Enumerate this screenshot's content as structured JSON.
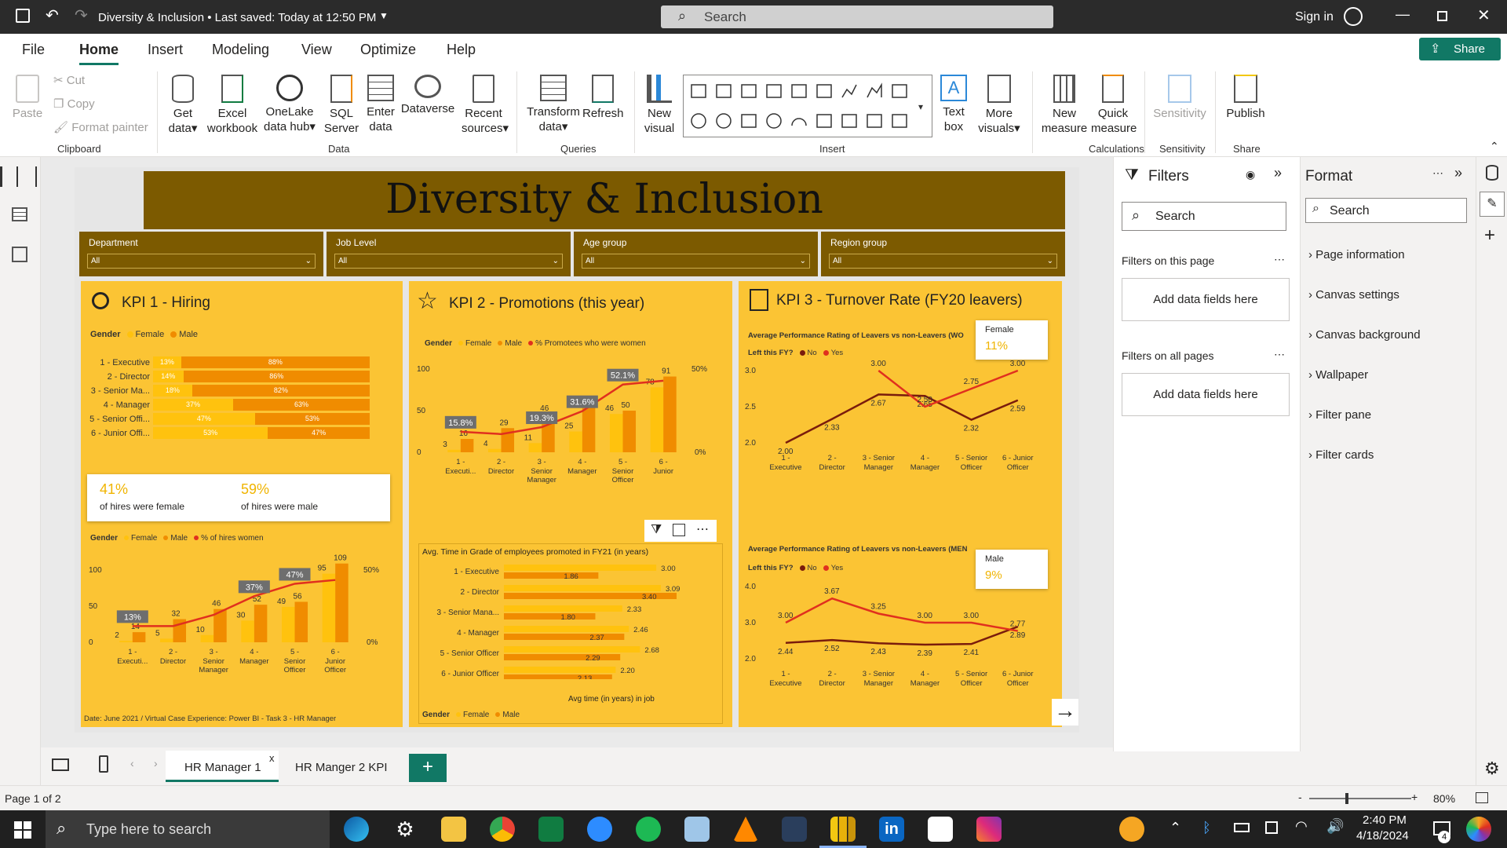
{
  "titlebar": {
    "title": "Diversity & Inclusion • Last saved: Today at 12:50 PM",
    "search": "Search",
    "signin": "Sign in"
  },
  "menu": {
    "items": [
      "File",
      "Home",
      "Insert",
      "Modeling",
      "View",
      "Optimize",
      "Help"
    ],
    "share": "Share"
  },
  "ribbon": {
    "clipboard": {
      "paste": "Paste",
      "cut": "Cut",
      "copy": "Copy",
      "format_painter": "Format painter",
      "group": "Clipboard"
    },
    "data": {
      "get_data": "Get data",
      "excel": "Excel workbook",
      "onelake": "OneLake data hub",
      "sql": "SQL Server",
      "enter": "Enter data",
      "dataverse": "Dataverse",
      "recent": "Recent sources",
      "group": "Data"
    },
    "queries": {
      "transform": "Transform data",
      "refresh": "Refresh",
      "group": "Queries"
    },
    "insert": {
      "new_visual": "New visual",
      "text_box": "Text box",
      "more_visuals": "More visuals",
      "group": "Insert"
    },
    "calculations": {
      "new_measure": "New measure",
      "quick_measure": "Quick measure",
      "group": "Calculations"
    },
    "sensitivity": {
      "label": "Sensitivity",
      "group": "Sensitivity"
    },
    "share": {
      "publish": "Publish",
      "group": "Share"
    }
  },
  "report": {
    "title": "Diversity & Inclusion",
    "slicers": [
      {
        "label": "Department",
        "value": "All"
      },
      {
        "label": "Job Level",
        "value": "All"
      },
      {
        "label": "Age group",
        "value": "All"
      },
      {
        "label": "Region group",
        "value": "All"
      }
    ],
    "kpi1": {
      "title": "KPI 1 - Hiring",
      "legend_title": "Gender",
      "legend": [
        "Female",
        "Male"
      ],
      "rows": [
        {
          "label": "1 - Executive",
          "female": "13%",
          "male": "88%",
          "f": 13
        },
        {
          "label": "2 - Director",
          "female": "14%",
          "male": "86%",
          "f": 14
        },
        {
          "label": "3 - Senior Ma...",
          "female": "18%",
          "male": "82%",
          "f": 18
        },
        {
          "label": "4 - Manager",
          "female": "37%",
          "male": "63%",
          "f": 37
        },
        {
          "label": "5 - Senior Offi...",
          "female": "47%",
          "male": "53%",
          "f": 47
        },
        {
          "label": "6 - Junior Offi...",
          "female": "53%",
          "male": "47%",
          "f": 53
        }
      ],
      "card": {
        "female_value": "41%",
        "female_label": "of hires were female",
        "male_value": "59%",
        "male_label": "of hires were male"
      },
      "chart_legend": [
        "Female",
        "Male",
        "% of hires women"
      ],
      "footer": "Date: June 2021 / Virtual Case Experience: Power BI - Task 3 - HR Manager"
    },
    "kpi2": {
      "title": "KPI 2 - Promotions (this year)",
      "legend_title": "Gender",
      "legend": [
        "Female",
        "Male",
        "% Promotees who were women"
      ],
      "table_title": "Avg. Time in Grade of employees promoted in FY21 (in years)",
      "table_xlabel": "Avg time (in years) in job",
      "rows": [
        {
          "label": "1 - Executive",
          "a": "1.86",
          "b": "3.00",
          "av": 1.86,
          "bv": 3.0
        },
        {
          "label": "2 - Director",
          "a": "3.40",
          "b": "3.09",
          "av": 3.4,
          "bv": 3.09
        },
        {
          "label": "3 - Senior Mana...",
          "a": "1.80",
          "b": "2.33",
          "av": 1.8,
          "bv": 2.33
        },
        {
          "label": "4 - Manager",
          "a": "2.37",
          "b": "2.46",
          "av": 2.37,
          "bv": 2.46
        },
        {
          "label": "5 - Senior Officer",
          "a": "2.29",
          "b": "2.68",
          "av": 2.29,
          "bv": 2.68
        },
        {
          "label": "6 - Junior Officer",
          "a": "2.13",
          "b": "2.20",
          "av": 2.13,
          "bv": 2.2
        }
      ],
      "bottom_legend": [
        "Female",
        "Male"
      ]
    },
    "kpi3": {
      "title": "KPI 3 - Turnover Rate (FY20 leavers)",
      "top": {
        "subtitle": "Average Performance Rating of Leavers vs non-Leavers (WO",
        "left_label": "Left this FY?",
        "legend": [
          "No",
          "Yes"
        ],
        "card_title": "Female",
        "card_value": "11%"
      },
      "bottom": {
        "subtitle": "Average Performance Rating of Leavers vs non-Leavers (MEN",
        "left_label": "Left this FY?",
        "legend": [
          "No",
          "Yes"
        ],
        "card_title": "Male",
        "card_value": "9%"
      }
    }
  },
  "chart_data": [
    {
      "type": "bar",
      "title": "KPI 1 - Hiring",
      "categories": [
        "1 - Executive",
        "2 - Director",
        "3 - Senior Manager",
        "4 - Manager",
        "5 - Senior Officer",
        "6 - Junior Officer"
      ],
      "series": [
        {
          "name": "Female",
          "values": [
            13,
            14,
            18,
            37,
            47,
            53
          ]
        },
        {
          "name": "Male",
          "values": [
            88,
            86,
            82,
            63,
            53,
            47
          ]
        }
      ]
    },
    {
      "type": "bar",
      "categories": [
        "1 - Executi...",
        "2 - Director",
        "3 - Senior Manager",
        "4 - Manager",
        "5 - Senior Officer",
        "6 - Junior Officer"
      ],
      "series": [
        {
          "name": "Female",
          "values": [
            2,
            5,
            10,
            30,
            49,
            95
          ]
        },
        {
          "name": "Male",
          "values": [
            14,
            32,
            46,
            52,
            56,
            109
          ]
        },
        {
          "name": "% of hires women",
          "values": [
            13,
            13,
            22,
            37,
            47,
            50
          ]
        }
      ],
      "ylim": [
        0,
        100
      ],
      "y2": [
        "0%",
        "50%"
      ]
    },
    {
      "type": "bar",
      "title": "KPI 2 - Promotions (this year)",
      "categories": [
        "1 - Executi...",
        "2 - Director",
        "3 - Senior Manager",
        "4 - Manager",
        "5 - Senior Officer",
        "6 - Junior"
      ],
      "series": [
        {
          "name": "Female",
          "values": [
            3,
            4,
            11,
            25,
            46,
            78
          ]
        },
        {
          "name": "Male",
          "values": [
            16,
            29,
            46,
            54,
            50,
            91
          ]
        },
        {
          "name": "% Promotees who were women",
          "values": [
            15.8,
            14,
            19.3,
            31.6,
            52.1,
            55
          ]
        }
      ],
      "ylim": [
        0,
        100
      ],
      "y2": [
        "0%",
        "50%"
      ]
    },
    {
      "type": "line",
      "title": "Average Performance Rating of Leavers vs non-Leavers (WO",
      "x": [
        "1 - Executive",
        "2 - Director",
        "3 - Senior Manager",
        "4 - Manager",
        "5 - Senior Officer",
        "6 - Junior Officer"
      ],
      "series": [
        {
          "name": "No",
          "values": [
            2.0,
            2.33,
            2.67,
            2.65,
            2.32,
            2.59
          ]
        },
        {
          "name": "Yes",
          "values": [
            null,
            null,
            3.0,
            2.5,
            2.75,
            3.0
          ]
        }
      ],
      "ylim": [
        2.0,
        3.0
      ]
    },
    {
      "type": "line",
      "title": "Average Performance Rating of Leavers vs non-Leavers (MEN",
      "x": [
        "1 - Executive",
        "2 - Director",
        "3 - Senior Manager",
        "4 - Manager",
        "5 - Senior Officer",
        "6 - Junior Officer"
      ],
      "series": [
        {
          "name": "No",
          "values": [
            2.44,
            2.52,
            2.43,
            2.39,
            2.41,
            2.89
          ]
        },
        {
          "name": "Yes",
          "values": [
            3.0,
            3.67,
            3.25,
            3.0,
            3.0,
            2.77
          ]
        }
      ],
      "ylim": [
        2,
        4
      ]
    }
  ],
  "filters": {
    "title": "Filters",
    "search": "Search",
    "on_page": "Filters on this page",
    "on_all": "Filters on all pages",
    "add": "Add data fields here"
  },
  "format": {
    "title": "Format",
    "search": "Search",
    "items": [
      "Page information",
      "Canvas settings",
      "Canvas background",
      "Wallpaper",
      "Filter pane",
      "Filter cards"
    ]
  },
  "tabs": {
    "tab1": "HR Manager 1",
    "tab2": "HR Manger 2 KPI",
    "close": "x"
  },
  "status": {
    "page": "Page 1 of 2",
    "zoom": "80%"
  },
  "taskbar": {
    "search": "Type here to search",
    "time": "2:40 PM",
    "date": "4/18/2024",
    "badge": "4"
  },
  "colors": {
    "female": "#ffc20e",
    "male": "#f08c00",
    "line": "#e0301e",
    "brown": "#7c5a00",
    "panel": "#fbc434"
  }
}
